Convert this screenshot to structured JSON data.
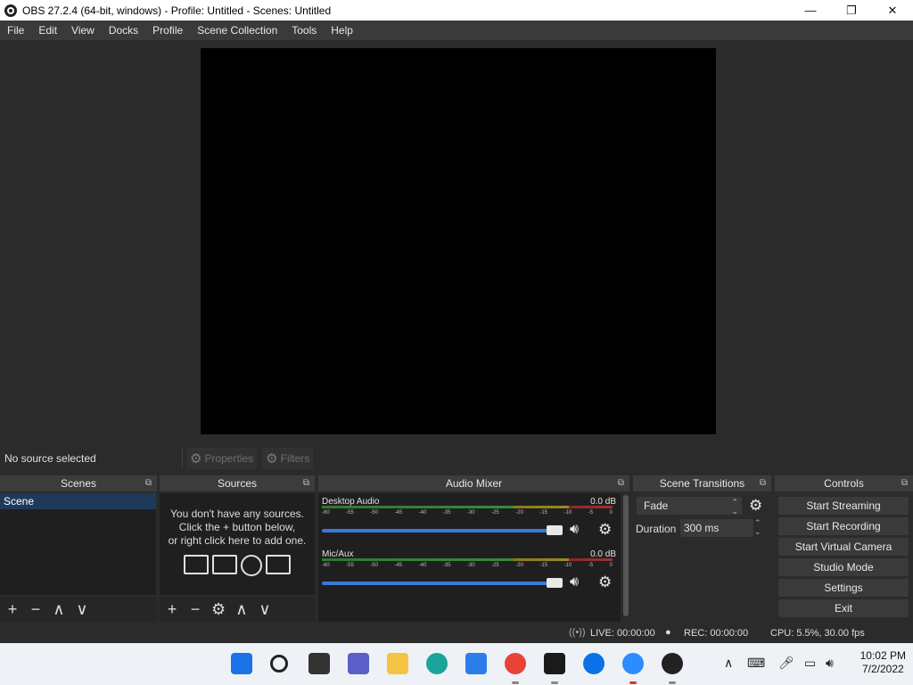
{
  "window": {
    "title": "OBS 27.2.4 (64-bit, windows) - Profile: Untitled - Scenes: Untitled",
    "minimize": "—",
    "restore": "❐",
    "close": "✕"
  },
  "menu": [
    "File",
    "Edit",
    "View",
    "Docks",
    "Profile",
    "Scene Collection",
    "Tools",
    "Help"
  ],
  "source_toolbar": {
    "status": "No source selected",
    "properties": "Properties",
    "filters": "Filters"
  },
  "scenes": {
    "title": "Scenes",
    "items": [
      "Scene"
    ]
  },
  "sources": {
    "title": "Sources",
    "empty_line1": "You don't have any sources.",
    "empty_line2": "Click the + button below,",
    "empty_line3": "or right click here to add one."
  },
  "mixer": {
    "title": "Audio Mixer",
    "ticks": [
      "-60",
      "-55",
      "-50",
      "-45",
      "-40",
      "-35",
      "-30",
      "-25",
      "-20",
      "-15",
      "-10",
      "-5",
      "0"
    ],
    "channels": [
      {
        "name": "Desktop Audio",
        "db": "0.0 dB",
        "volume": 1.0
      },
      {
        "name": "Mic/Aux",
        "db": "0.0 dB",
        "volume": 1.0
      }
    ]
  },
  "transitions": {
    "title": "Scene Transitions",
    "selected": "Fade",
    "duration_label": "Duration",
    "duration_value": "300 ms"
  },
  "controls": {
    "title": "Controls",
    "buttons": [
      "Start Streaming",
      "Start Recording",
      "Start Virtual Camera",
      "Studio Mode",
      "Settings",
      "Exit"
    ]
  },
  "status": {
    "live": "LIVE: 00:00:00",
    "rec": "REC: 00:00:00",
    "cpu": "CPU: 5.5%, 30.00 fps"
  },
  "taskbar": {
    "time": "10:02 PM",
    "date": "7/2/2022",
    "icons": [
      "windows-start-icon",
      "search-icon",
      "task-view-icon",
      "teams-chat-icon",
      "file-explorer-icon",
      "edge-icon",
      "store-icon",
      "chrome-icon",
      "terminal-icon",
      "zalo-icon",
      "zoom-icon",
      "obs-icon"
    ]
  },
  "colors": {
    "panel": "#2b2b2b",
    "list_bg": "#1f1f1f",
    "selection": "#1e3a5a",
    "slider": "#3a7ad6"
  }
}
